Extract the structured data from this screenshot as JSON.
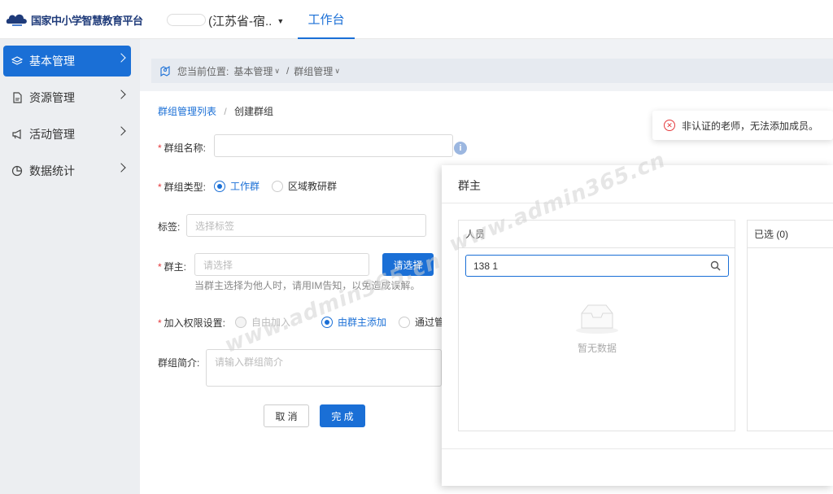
{
  "header": {
    "platform_name": "国家中小学智慧教育平台",
    "region": "(江苏省-宿..",
    "nav_tab": "工作台"
  },
  "sidebar": {
    "items": [
      {
        "label": "基本管理",
        "icon": "layers-icon",
        "active": true
      },
      {
        "label": "资源管理",
        "icon": "document-icon",
        "active": false
      },
      {
        "label": "活动管理",
        "icon": "megaphone-icon",
        "active": false
      },
      {
        "label": "数据统计",
        "icon": "pie-chart-icon",
        "active": false
      }
    ]
  },
  "location_bar": {
    "prefix": "您当前位置:",
    "level1": "基本管理",
    "level2": "群组管理"
  },
  "breadcrumb": {
    "parent": "群组管理列表",
    "current": "创建群组"
  },
  "form": {
    "name_label": "群组名称:",
    "type_label": "群组类型:",
    "type_options": [
      "工作群",
      "区域教研群"
    ],
    "tag_label": "标签:",
    "tag_placeholder": "选择标签",
    "owner_label": "群主:",
    "owner_placeholder": "请选择",
    "owner_button": "请选择",
    "owner_hint": "当群主选择为他人时，请用IM告知，以免造成误解。",
    "permission_label": "加入权限设置:",
    "permission_options": [
      "自由加入",
      "由群主添加",
      "通过管"
    ],
    "intro_label": "群组简介:",
    "intro_placeholder": "请输入群组简介",
    "cancel_button": "取 消",
    "submit_button": "完 成"
  },
  "toast": {
    "message": "非认证的老师，无法添加成员。"
  },
  "modal": {
    "title": "群主",
    "left_title": "人员",
    "search_value": "138            1",
    "empty_text": "暂无数据",
    "right_title": "已选 (0)"
  },
  "watermark": "www.admin365.cn",
  "colors": {
    "accent": "#1a6fd6",
    "error": "#e4393c",
    "sidebar_bg": "#eceef1"
  }
}
